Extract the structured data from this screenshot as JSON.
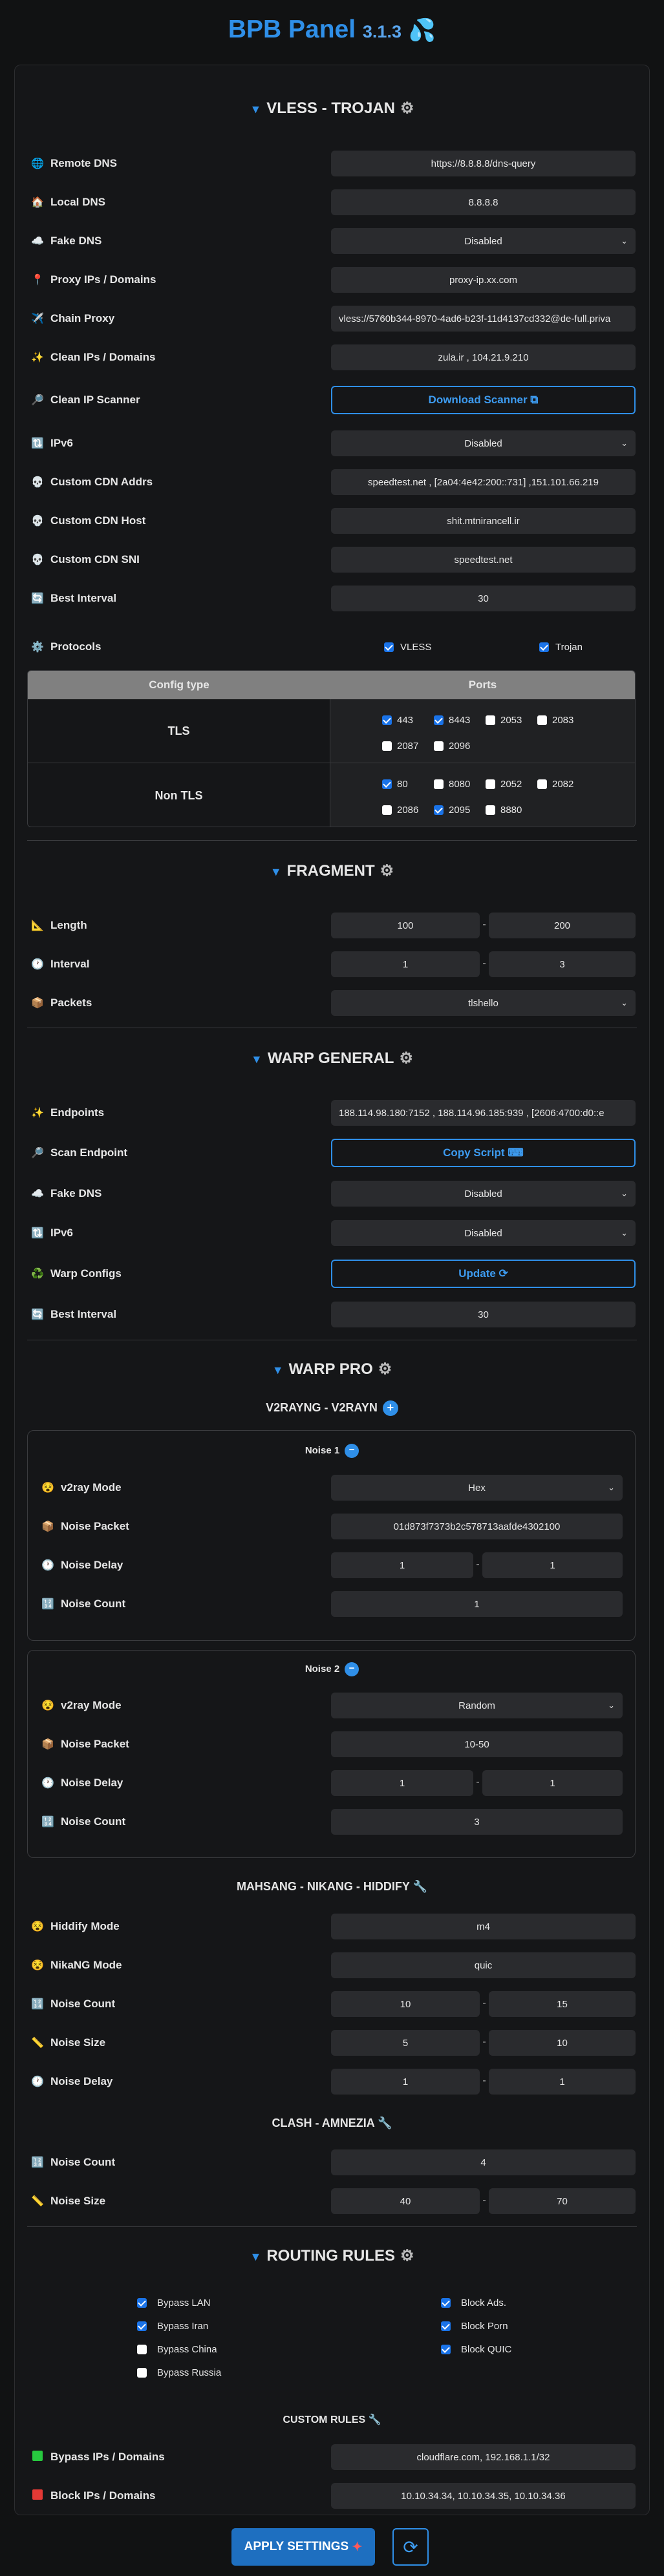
{
  "app": {
    "title": "BPB Panel",
    "version": "3.1.3"
  },
  "vless": {
    "header": "VLESS - TROJAN",
    "rows": [
      {
        "label": "Remote DNS",
        "value": "https://8.8.8.8/dns-query",
        "icon": "globe-icon"
      },
      {
        "label": "Local DNS",
        "value": "8.8.8.8",
        "icon": "house-icon"
      },
      {
        "label": "Fake DNS",
        "value": "Disabled",
        "icon": "cloud-icon"
      },
      {
        "label": "Proxy IPs / Domains",
        "value": "proxy-ip.xx.com",
        "icon": "pin-icon"
      },
      {
        "label": "Chain Proxy",
        "value": "vless://5760b344-8970-4ad6-b23f-11d4137cd332@de-full.priva",
        "icon": "plane-icon"
      },
      {
        "label": "Clean IPs / Domains",
        "value": "zula.ir , 104.21.9.210",
        "icon": "sparkle-icon"
      },
      {
        "label": "Clean IP Scanner",
        "value": "Download Scanner",
        "icon": "magnifier-icon"
      },
      {
        "label": "IPv6",
        "value": "Disabled",
        "icon": "arrows-icon"
      },
      {
        "label": "Custom CDN Addrs",
        "value": "speedtest.net , [2a04:4e42:200::731] ,151.101.66.219",
        "icon": "skull-icon"
      },
      {
        "label": "Custom CDN Host",
        "value": "shit.mtnirancell.ir",
        "icon": "skull-icon"
      },
      {
        "label": "Custom CDN SNI",
        "value": "speedtest.net",
        "icon": "skull-icon"
      },
      {
        "label": "Best Interval",
        "value": "30",
        "icon": "refresh-icon"
      }
    ],
    "protocols": {
      "label": "Protocols",
      "vless": "VLESS",
      "trojan": "Trojan"
    },
    "table": {
      "col1": "Config type",
      "col2": "Ports",
      "tls": "TLS",
      "nontls": "Non TLS",
      "tls_ports": [
        {
          "p": "443",
          "on": true
        },
        {
          "p": "8443",
          "on": true
        },
        {
          "p": "2053",
          "on": false
        },
        {
          "p": "2083",
          "on": false
        },
        {
          "p": "2087",
          "on": false
        },
        {
          "p": "2096",
          "on": false
        }
      ],
      "nontls_ports": [
        {
          "p": "80",
          "on": true
        },
        {
          "p": "8080",
          "on": false
        },
        {
          "p": "2052",
          "on": false
        },
        {
          "p": "2082",
          "on": false
        },
        {
          "p": "2086",
          "on": false
        },
        {
          "p": "2095",
          "on": true
        },
        {
          "p": "8880",
          "on": false
        }
      ]
    }
  },
  "fragment": {
    "header": "FRAGMENT",
    "length": {
      "label": "Length",
      "min": "100",
      "max": "200"
    },
    "interval": {
      "label": "Interval",
      "min": "1",
      "max": "3"
    },
    "packets": {
      "label": "Packets",
      "value": "tlshello"
    }
  },
  "warp": {
    "header": "WARP GENERAL",
    "endpoints": {
      "label": "Endpoints",
      "value": "188.114.98.180:7152 , 188.114.96.185:939 , [2606:4700:d0::e"
    },
    "scan": {
      "label": "Scan Endpoint",
      "value": "Copy Script"
    },
    "fakedns": {
      "label": "Fake DNS",
      "value": "Disabled"
    },
    "ipv6": {
      "label": "IPv6",
      "value": "Disabled"
    },
    "configs": {
      "label": "Warp Configs",
      "value": "Update"
    },
    "interval": {
      "label": "Best Interval",
      "value": "30"
    }
  },
  "warppro": {
    "header": "WARP PRO",
    "v2ray_title": "V2RAYNG - V2RAYN",
    "noise1": {
      "title": "Noise 1",
      "mode_label": "v2ray Mode",
      "mode": "Hex",
      "packet_label": "Noise Packet",
      "packet": "01d873f7373b2c578713aafde4302100",
      "delay_label": "Noise Delay",
      "delay_min": "1",
      "delay_max": "1",
      "count_label": "Noise Count",
      "count": "1"
    },
    "noise2": {
      "title": "Noise 2",
      "mode_label": "v2ray Mode",
      "mode": "Random",
      "packet_label": "Noise Packet",
      "packet": "10-50",
      "delay_label": "Noise Delay",
      "delay_min": "1",
      "delay_max": "1",
      "count_label": "Noise Count",
      "count": "3"
    },
    "mahsang_title": "MAHSANG - NIKANG - HIDDIFY",
    "hiddify": {
      "label": "Hiddify Mode",
      "value": "m4"
    },
    "nikang": {
      "label": "NikaNG Mode",
      "value": "quic"
    },
    "mcount": {
      "label": "Noise Count",
      "min": "10",
      "max": "15"
    },
    "msize": {
      "label": "Noise Size",
      "min": "5",
      "max": "10"
    },
    "mdelay": {
      "label": "Noise Delay",
      "min": "1",
      "max": "1"
    },
    "clash_title": "CLASH - AMNEZIA",
    "ccount": {
      "label": "Noise Count",
      "value": "4"
    },
    "csize": {
      "label": "Noise Size",
      "min": "40",
      "max": "70"
    }
  },
  "routing": {
    "header": "ROUTING RULES",
    "left": [
      {
        "t": "Bypass LAN",
        "on": true
      },
      {
        "t": "Bypass Iran",
        "on": true
      },
      {
        "t": "Bypass China",
        "on": false
      },
      {
        "t": "Bypass Russia",
        "on": false
      }
    ],
    "right": [
      {
        "t": "Block Ads.",
        "on": true
      },
      {
        "t": "Block Porn",
        "on": true
      },
      {
        "t": "Block QUIC",
        "on": true
      }
    ],
    "custom_title": "CUSTOM RULES",
    "bypass": {
      "label": "Bypass IPs / Domains",
      "value": "cloudflare.com, 192.168.1.1/32"
    },
    "block": {
      "label": "Block IPs / Domains",
      "value": "10.10.34.34, 10.10.34.35, 10.10.34.36"
    }
  },
  "apply": "APPLY SETTINGS"
}
